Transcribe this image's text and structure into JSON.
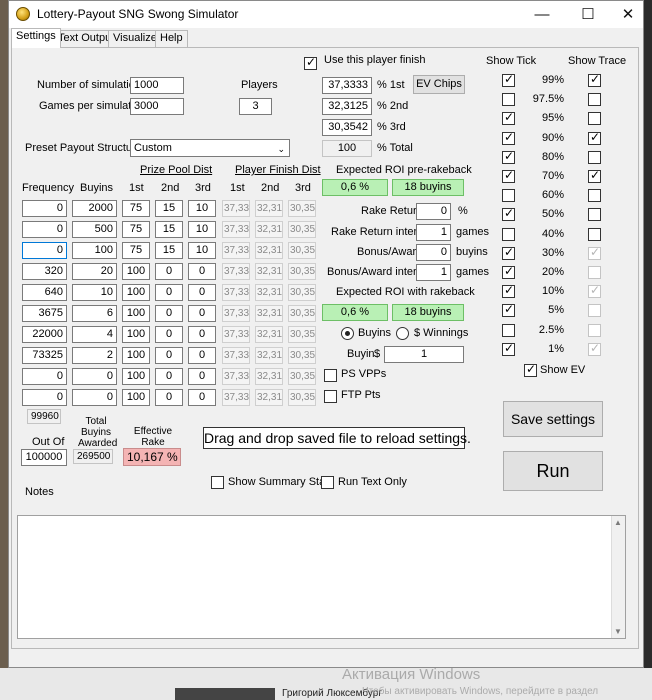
{
  "window": {
    "title": "Lottery-Payout SNG Swong Simulator",
    "minimize": "—",
    "maximize": "☐",
    "close": "✕"
  },
  "tabs": [
    "Settings",
    "Text Output",
    "Visualizer",
    "Help"
  ],
  "settings": {
    "num_sims_label": "Number of simulations",
    "num_sims_value": "1000",
    "games_per_sim_label": "Games per simulation",
    "games_per_sim_value": "3000",
    "players_label": "Players",
    "players_value": "3",
    "use_player_finish_label": "Use this player finish",
    "use_player_finish_checked": true,
    "finish_1st": "37,3333",
    "finish_1st_label": "% 1st",
    "finish_2nd": "32,3125",
    "finish_2nd_label": "% 2nd",
    "finish_3rd": "30,3542",
    "finish_3rd_label": "% 3rd",
    "finish_total": "100",
    "finish_total_label": "% Total",
    "ev_chips_button": "EV Chips",
    "preset_label": "Preset Payout Structures",
    "preset_value": "Custom",
    "prize_pool_dist_label": "Prize Pool Dist",
    "player_finish_dist_label": "Player Finish Dist",
    "col_frequency": "Frequency",
    "col_buyins": "Buyins",
    "col_1st": "1st",
    "col_2nd": "2nd",
    "col_3rd": "3rd",
    "rows": [
      {
        "freq": "0",
        "buyins": "2000",
        "p1": "75",
        "p2": "15",
        "p3": "10",
        "f1": "37,33",
        "f2": "32,31",
        "f3": "30,35"
      },
      {
        "freq": "0",
        "buyins": "500",
        "p1": "75",
        "p2": "15",
        "p3": "10",
        "f1": "37,33",
        "f2": "32,31",
        "f3": "30,35"
      },
      {
        "freq": "0",
        "buyins": "100",
        "p1": "75",
        "p2": "15",
        "p3": "10",
        "f1": "37,33",
        "f2": "32,31",
        "f3": "30,35"
      },
      {
        "freq": "320",
        "buyins": "20",
        "p1": "100",
        "p2": "0",
        "p3": "0",
        "f1": "37,33",
        "f2": "32,31",
        "f3": "30,35"
      },
      {
        "freq": "640",
        "buyins": "10",
        "p1": "100",
        "p2": "0",
        "p3": "0",
        "f1": "37,33",
        "f2": "32,31",
        "f3": "30,35"
      },
      {
        "freq": "3675",
        "buyins": "6",
        "p1": "100",
        "p2": "0",
        "p3": "0",
        "f1": "37,33",
        "f2": "32,31",
        "f3": "30,35"
      },
      {
        "freq": "22000",
        "buyins": "4",
        "p1": "100",
        "p2": "0",
        "p3": "0",
        "f1": "37,33",
        "f2": "32,31",
        "f3": "30,35"
      },
      {
        "freq": "73325",
        "buyins": "2",
        "p1": "100",
        "p2": "0",
        "p3": "0",
        "f1": "37,33",
        "f2": "32,31",
        "f3": "30,35"
      },
      {
        "freq": "0",
        "buyins": "0",
        "p1": "100",
        "p2": "0",
        "p3": "0",
        "f1": "37,33",
        "f2": "32,31",
        "f3": "30,35"
      },
      {
        "freq": "0",
        "buyins": "0",
        "p1": "100",
        "p2": "0",
        "p3": "0",
        "f1": "37,33",
        "f2": "32,31",
        "f3": "30,35"
      }
    ],
    "roi_pre_label": "Expected ROI pre-rakeback",
    "roi_pre_pct": "0,6 %",
    "roi_pre_buyins": "18 buyins",
    "rake_return_label": "Rake Return",
    "rake_return_value": "0",
    "rake_return_unit": "%",
    "rake_interval_label": "Rake Return interval",
    "rake_interval_value": "1",
    "rake_interval_unit": "games",
    "bonus_label": "Bonus/Award",
    "bonus_value": "0",
    "bonus_unit": "buyins",
    "bonus_interval_label": "Bonus/Award interval",
    "bonus_interval_value": "1",
    "bonus_interval_unit": "games",
    "roi_rb_label": "Expected ROI with rakeback",
    "roi_rb_pct": "0,6 %",
    "roi_rb_buyins": "18 buyins",
    "radio_buyins": "Buyins",
    "radio_winnings": "$ Winnings",
    "buyin_label": "Buyin",
    "buyin_currency": "$",
    "buyin_value": "1",
    "ps_vpps": "PS VPPs",
    "ftp_pts": "FTP Pts",
    "sum_freq": "99960",
    "out_of_label": "Out Of",
    "out_of_value": "100000",
    "total_buyins_label": "Total Buyins Awarded",
    "total_buyins_value": "269500",
    "eff_rake_label": "Effective Rake",
    "eff_rake_value": "10,167 %",
    "drag_drop_text": "Drag and drop saved file to reload settings.",
    "show_summary_stats": "Show Summary Stats",
    "run_text_only": "Run Text Only",
    "notes_label": "Notes",
    "save_button": "Save settings",
    "run_button": "Run",
    "show_tick_label": "Show Tick",
    "show_trace_label": "Show Trace",
    "percentiles": [
      {
        "label": "99%",
        "tick": true,
        "trace": true,
        "trace_disabled": false
      },
      {
        "label": "97.5%",
        "tick": false,
        "trace": false,
        "trace_disabled": false
      },
      {
        "label": "95%",
        "tick": true,
        "trace": false,
        "trace_disabled": false
      },
      {
        "label": "90%",
        "tick": true,
        "trace": true,
        "trace_disabled": false
      },
      {
        "label": "80%",
        "tick": true,
        "trace": false,
        "trace_disabled": false
      },
      {
        "label": "70%",
        "tick": true,
        "trace": true,
        "trace_disabled": false
      },
      {
        "label": "60%",
        "tick": false,
        "trace": false,
        "trace_disabled": false
      },
      {
        "label": "50%",
        "tick": true,
        "trace": false,
        "trace_disabled": false
      },
      {
        "label": "40%",
        "tick": false,
        "trace": false,
        "trace_disabled": false
      },
      {
        "label": "30%",
        "tick": true,
        "trace": true,
        "trace_disabled": true
      },
      {
        "label": "20%",
        "tick": true,
        "trace": false,
        "trace_disabled": true
      },
      {
        "label": "10%",
        "tick": true,
        "trace": true,
        "trace_disabled": true
      },
      {
        "label": "5%",
        "tick": true,
        "trace": false,
        "trace_disabled": true
      },
      {
        "label": "2.5%",
        "tick": false,
        "trace": false,
        "trace_disabled": true
      },
      {
        "label": "1%",
        "tick": true,
        "trace": true,
        "trace_disabled": true
      }
    ],
    "show_ev_label": "Show EV",
    "show_ev_checked": true
  },
  "background": {
    "watermark_title": "Активация Windows",
    "watermark_sub": "Чтобы активировать Windows, перейдите в раздел",
    "taskbar_text": "Григорий Люксембург"
  }
}
